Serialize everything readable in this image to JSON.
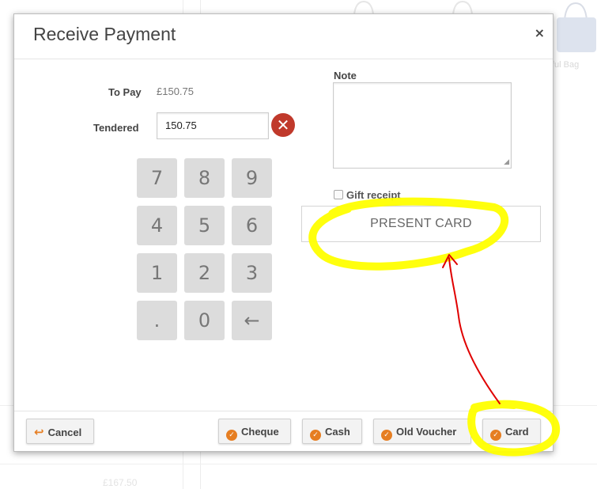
{
  "background": {
    "price_text": "£167.50",
    "bag_label": "ful Bag"
  },
  "modal": {
    "title": "Receive Payment",
    "close_glyph": "×"
  },
  "payment": {
    "to_pay_label": "To Pay",
    "to_pay_value": "£150.75",
    "tendered_label": "Tendered",
    "tendered_value": "150.75",
    "clear_glyph": "✕"
  },
  "keypad": {
    "keys": [
      "7",
      "8",
      "9",
      "4",
      "5",
      "6",
      "1",
      "2",
      "3",
      ".",
      "0",
      "←"
    ]
  },
  "note": {
    "label": "Note",
    "value": ""
  },
  "gift_receipt": {
    "label": "Gift receipt",
    "checked": false
  },
  "present_card": {
    "label": "PRESENT CARD"
  },
  "footer": {
    "cancel_label": "Cancel",
    "cheque_label": "Cheque",
    "cash_label": "Cash",
    "old_voucher_label": "Old Voucher",
    "card_label": "Card"
  },
  "colors": {
    "accent_orange": "#e67e22",
    "clear_red": "#c0392b",
    "annotation_yellow": "#ffff00",
    "annotation_red": "#e00000"
  },
  "icons": {
    "cancel": "undo-arrow-icon",
    "pay_buttons": "orange-check-circle-icon",
    "clear": "red-x-circle-icon",
    "close": "close-icon"
  }
}
